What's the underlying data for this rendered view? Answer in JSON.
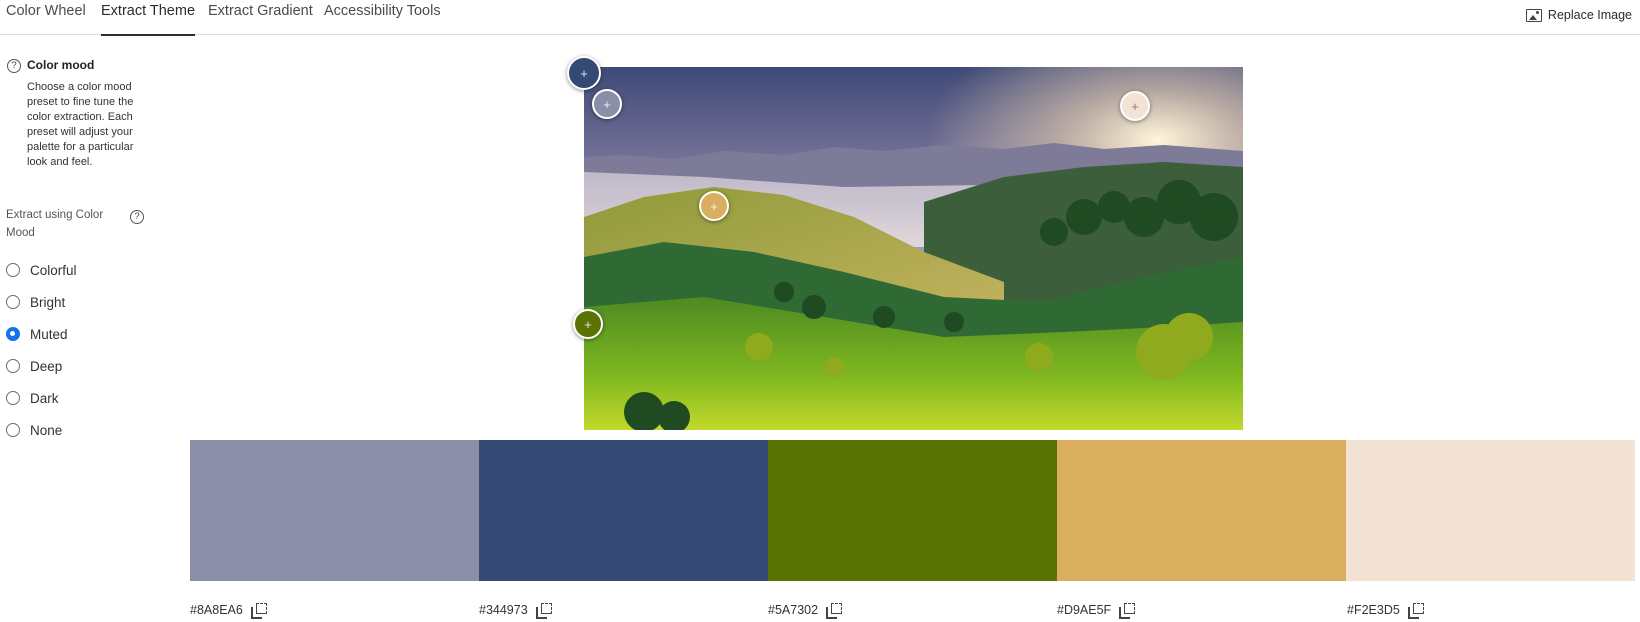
{
  "nav": {
    "tabs": [
      {
        "label": "Color Wheel"
      },
      {
        "label": "Extract Theme"
      },
      {
        "label": "Extract Gradient"
      },
      {
        "label": "Accessibility Tools"
      }
    ],
    "active_tab": "Extract Theme",
    "replace_image_label": "Replace Image"
  },
  "sidebar": {
    "help_glyph": "?",
    "mood_title": "Color mood",
    "mood_description": "Choose a color mood preset to fine tune the color extraction. Each preset will adjust your palette for a particular look and feel.",
    "extract_label": "Extract using Color Mood",
    "options": [
      {
        "label": "Colorful",
        "checked": false
      },
      {
        "label": "Bright",
        "checked": false
      },
      {
        "label": "Muted",
        "checked": true
      },
      {
        "label": "Deep",
        "checked": false
      },
      {
        "label": "Dark",
        "checked": false
      },
      {
        "label": "None",
        "checked": false
      }
    ]
  },
  "picker_glyph": "+",
  "swatches": [
    {
      "hex": "#8A8EA6",
      "color": "#8A8EA6"
    },
    {
      "hex": "#344973",
      "color": "#344973"
    },
    {
      "hex": "#5A7302",
      "color": "#5A7302"
    },
    {
      "hex": "#D9AE5F",
      "color": "#D9AE5F"
    },
    {
      "hex": "#F2E3D5",
      "color": "#F2E3D5"
    }
  ]
}
